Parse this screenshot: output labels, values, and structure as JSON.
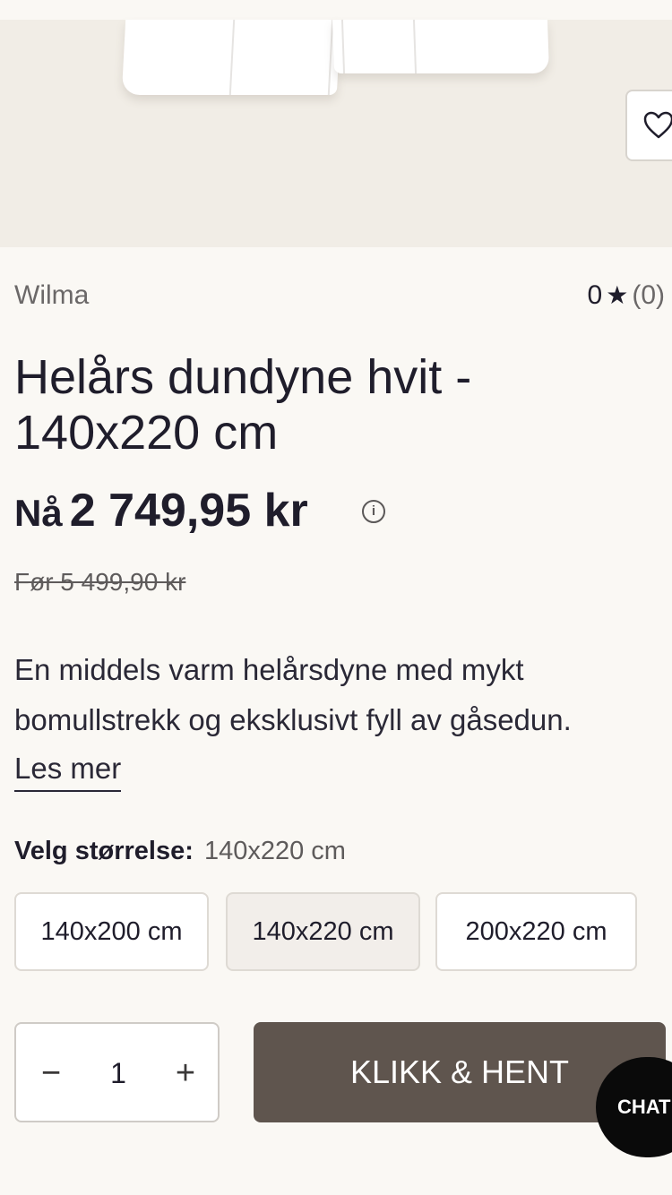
{
  "hero": {
    "image_desc": "white duvets",
    "favorite_icon": "heart-outline-icon"
  },
  "product": {
    "brand": "Wilma",
    "rating_value": "0",
    "rating_star": "★",
    "rating_count": "(0)",
    "title": "Helårs dundyne hvit - 140x220 cm",
    "price_prefix": "Nå",
    "price": "2 749,95 kr",
    "info_icon": "i",
    "before_price": "Før 5 499,90 kr",
    "description": "En middels varm helårsdyne med mykt bomullstrekk og eksklusivt fyll av gåsedun.",
    "read_more": "Les mer"
  },
  "size": {
    "label": "Velg størrelse:",
    "current": "140x220 cm",
    "options": [
      {
        "label": "140x200 cm",
        "selected": false
      },
      {
        "label": "140x220 cm",
        "selected": true
      },
      {
        "label": "200x220 cm",
        "selected": false
      }
    ]
  },
  "cart": {
    "minus": "−",
    "quantity": "1",
    "plus": "+",
    "buy_label": "KLIKK & HENT"
  },
  "chat": {
    "label": "CHAT"
  },
  "colors": {
    "background": "#faf8f4",
    "buy_button": "#5f554e",
    "text": "#1f1d2b",
    "chat_button": "#0a0a0a"
  }
}
